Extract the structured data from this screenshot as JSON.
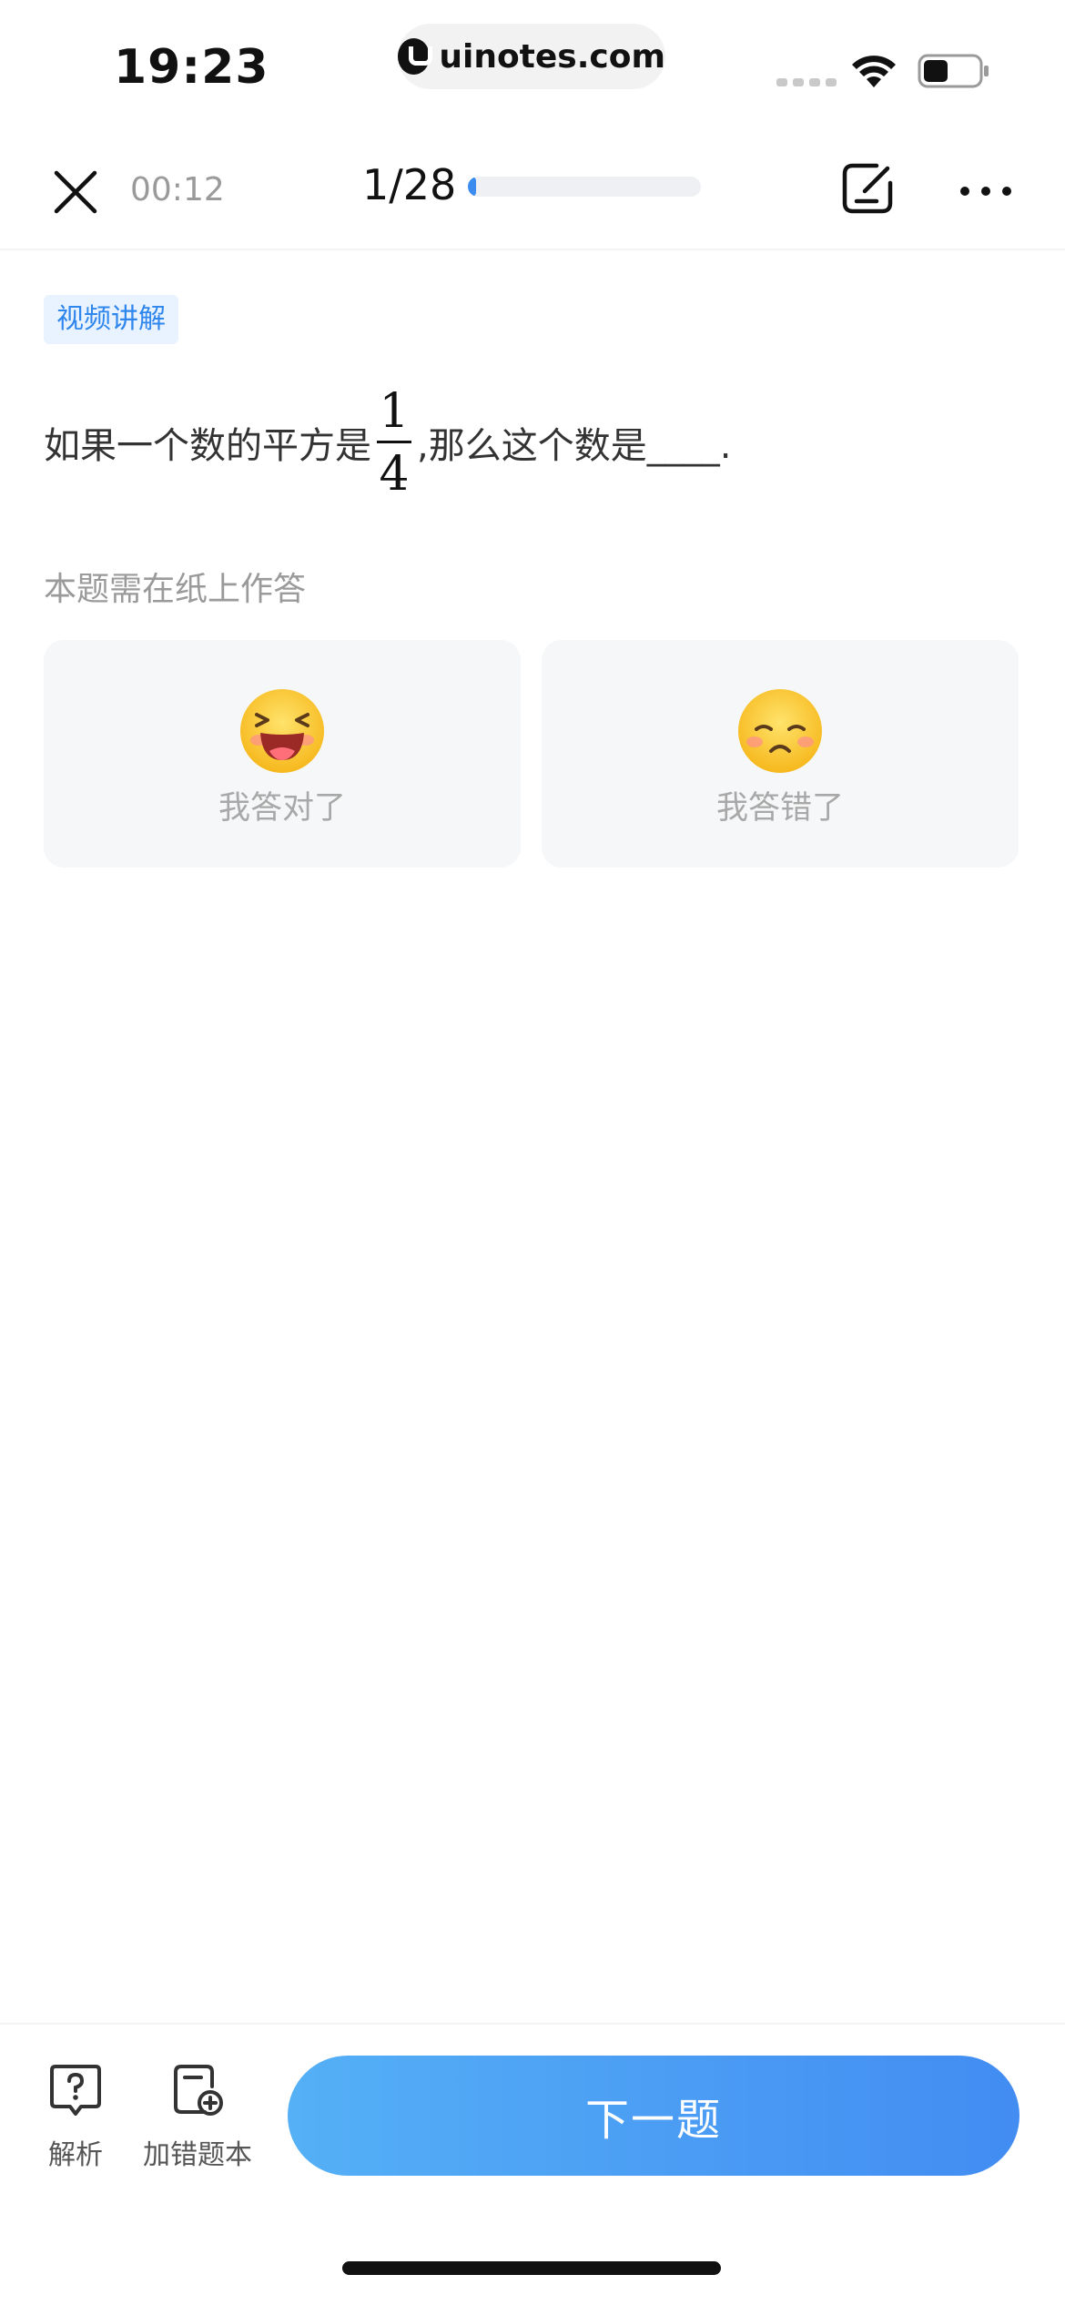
{
  "status_bar": {
    "time": "19:23",
    "url": "uinotes.com"
  },
  "top_nav": {
    "timer": "00:12",
    "counter": "1/28",
    "progress_fraction": 0.036,
    "accent_color": "#3c8cf0",
    "icons": [
      "close-icon",
      "draft-icon",
      "more-icon"
    ]
  },
  "question": {
    "tag": "视频讲解",
    "text_before": "如果一个数的平方是",
    "fraction_numerator": "1",
    "fraction_denominator": "4",
    "text_after": ",那么这个数是____.",
    "paper_hint": "本题需在纸上作答"
  },
  "choices": {
    "correct_label": "我答对了",
    "wrong_label": "我答错了",
    "correct_icon": "laughing-emoji-icon",
    "wrong_icon": "sad-emoji-icon"
  },
  "bottom_bar": {
    "analysis_label": "解析",
    "add_wrong_label": "加错题本",
    "next_label": "下一题",
    "next_gradient": [
      "#55b0f6",
      "#428cf2"
    ]
  }
}
